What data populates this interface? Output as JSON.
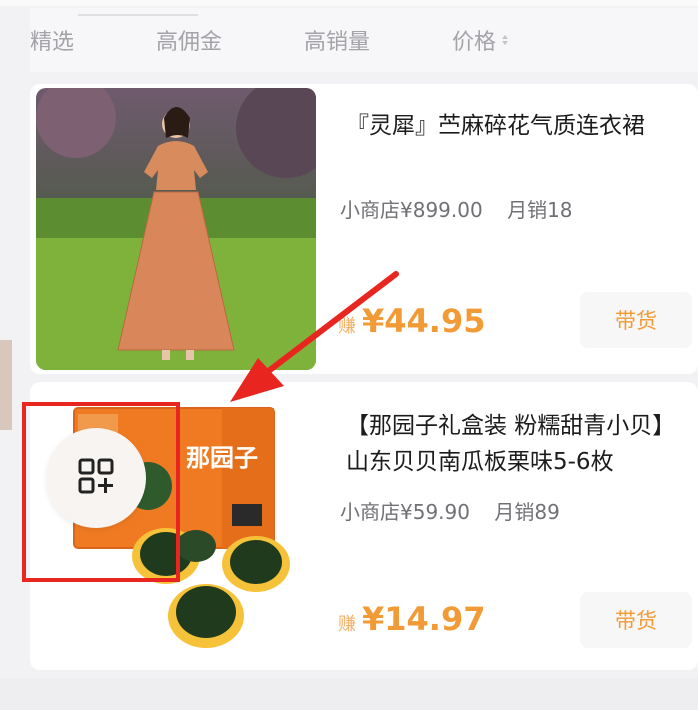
{
  "tabs": [
    {
      "label": "精选",
      "active": true
    },
    {
      "label": "高佣金",
      "active": false
    },
    {
      "label": "高销量",
      "active": false
    },
    {
      "label": "价格",
      "active": false,
      "sortable": true
    }
  ],
  "products": [
    {
      "title": "『灵犀』苎麻碎花气质连衣裙",
      "shop": "小商店",
      "price": "¥899.00",
      "monthly_sales": "月销18",
      "earn_label": "赚",
      "earn_amount": "¥44.95",
      "button": "带货"
    },
    {
      "title": "【那园子礼盒装 粉糯甜青小贝】山东贝贝南瓜板栗味5-6枚",
      "shop": "小商店",
      "price": "¥59.90",
      "monthly_sales": "月销89",
      "earn_label": "赚",
      "earn_amount": "¥14.97",
      "button": "带货",
      "package_text": "那园子"
    }
  ],
  "colors": {
    "accent_orange": "#f29b36",
    "highlight_red": "#e8251e"
  },
  "icons": {
    "overlay": "qr-add-icon"
  }
}
